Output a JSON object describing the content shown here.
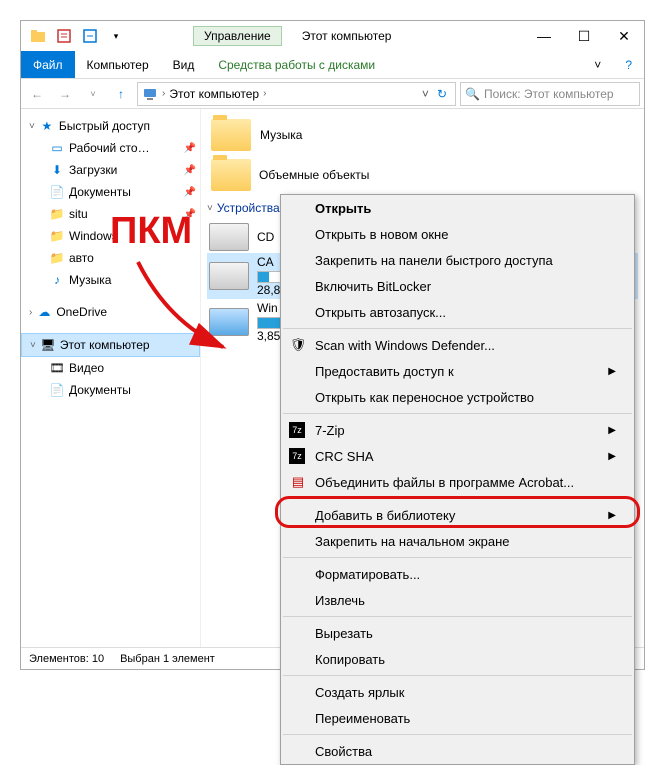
{
  "window": {
    "ribbon_context_tab": "Управление",
    "title": "Этот компьютер"
  },
  "ribbon": {
    "file": "Файл",
    "computer": "Компьютер",
    "view": "Вид",
    "drive_tools": "Средства работы с дисками"
  },
  "breadcrumb": {
    "root": "Этот компьютер",
    "sep": "›"
  },
  "search": {
    "placeholder": "Поиск: Этот компьютер"
  },
  "nav": {
    "quick_access": "Быстрый доступ",
    "desktop": "Рабочий сто…",
    "downloads": "Загрузки",
    "documents": "Документы",
    "situ": "situ",
    "windows": "Windows",
    "avto": "авто",
    "music": "Музыка",
    "onedrive": "OneDrive",
    "this_pc": "Этот компьютер",
    "videos": "Видео",
    "documents2": "Документы"
  },
  "content": {
    "music": "Музыка",
    "objects3d": "Объемные объекты",
    "group": "Устройства…",
    "cd": "CD",
    "ca": "CA",
    "ca_size": "28,8",
    "win": "Win",
    "win_size": "3,85"
  },
  "statusbar": {
    "items": "Элементов: 10",
    "selected": "Выбран 1 элемент"
  },
  "ctx": {
    "open": "Открыть",
    "open_new": "Открыть в новом окне",
    "pin_qa": "Закрепить на панели быстрого доступа",
    "bitlocker": "Включить BitLocker",
    "autoplay": "Открыть автозапуск...",
    "defender": "Scan with Windows Defender...",
    "share": "Предоставить доступ к",
    "portable": "Открыть как переносное устройство",
    "7zip": "7-Zip",
    "crc": "CRC SHA",
    "acrobat": "Объединить файлы в программе Acrobat...",
    "library": "Добавить в библиотеку",
    "pin_start": "Закрепить на начальном экране",
    "format": "Форматировать...",
    "eject": "Извлечь",
    "cut": "Вырезать",
    "copy": "Копировать",
    "shortcut": "Создать ярлык",
    "rename": "Переименовать",
    "properties": "Свойства"
  },
  "annotation": {
    "label": "ПКМ"
  }
}
